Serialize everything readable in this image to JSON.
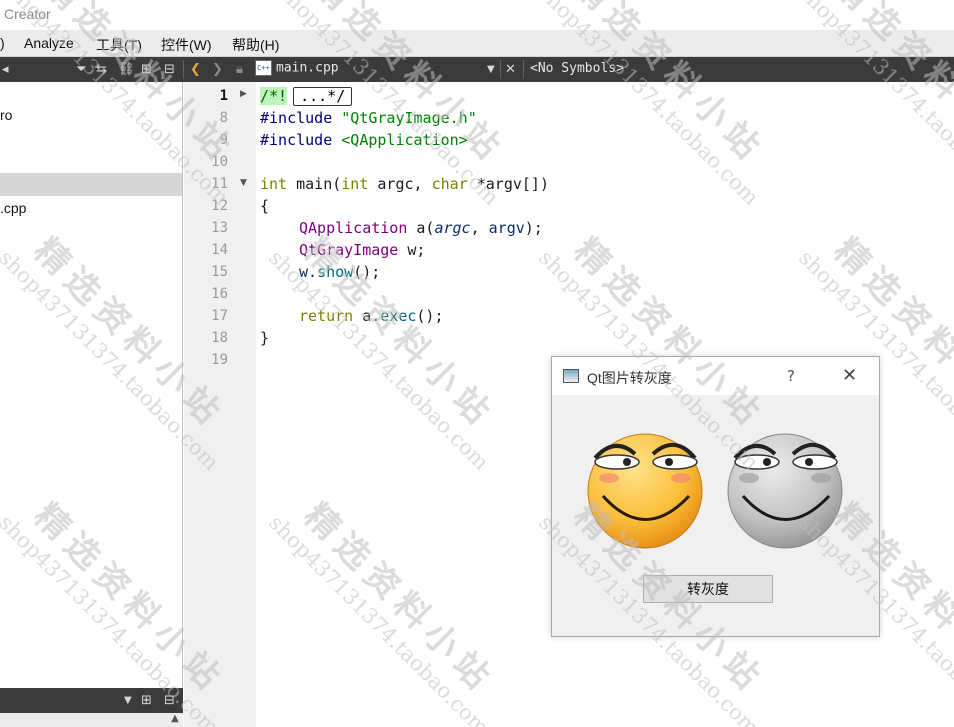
{
  "window": {
    "title": "Creator"
  },
  "menu": [
    {
      "label": ")"
    },
    {
      "label": "Analyze"
    },
    {
      "label": "工具(T)"
    },
    {
      "label": "控件(W)"
    },
    {
      "label": "帮助(H)"
    }
  ],
  "toolbar": {
    "file_tab": "main.cpp",
    "file_badge": "C++",
    "symbols": "<No Symbols>"
  },
  "left_panel": {
    "items": [
      {
        "label": "ro"
      },
      {
        "label": ".cpp"
      }
    ]
  },
  "editor": {
    "lines": [
      {
        "number": "1",
        "current": true,
        "fold": "▶"
      },
      {
        "number": "8"
      },
      {
        "number": "9"
      },
      {
        "number": "10"
      },
      {
        "number": "11",
        "fold": "▼"
      },
      {
        "number": "12"
      },
      {
        "number": "13"
      },
      {
        "number": "14"
      },
      {
        "number": "15"
      },
      {
        "number": "16"
      },
      {
        "number": "17"
      },
      {
        "number": "18"
      },
      {
        "number": "19"
      }
    ],
    "code": {
      "l1_comment": "/*!",
      "l1_collapsed": "...*/",
      "l8_directive": "#include",
      "l8_file": "\"QtGrayImage.h\"",
      "l9_directive": "#include",
      "l9_file": "<QApplication>",
      "l11_int": "int",
      "l11_main": " main(",
      "l11_int2": "int",
      "l11_argc": " argc, ",
      "l11_char": "char",
      "l11_rest": " *argv[])",
      "l12": "{",
      "l13_type": "QApplication",
      "l13_mid": " a(",
      "l13_argc": "argc",
      "l13_sep": ", ",
      "l13_argv": "argv",
      "l13_end": ");",
      "l14_type": "QtGrayImage",
      "l14_rest": " w;",
      "l15_w": "w.",
      "l15_show": "show",
      "l15_end": "();",
      "l17_return": "return",
      "l17_a": " a.",
      "l17_exec": "exec",
      "l17_end": "();",
      "l18": "}"
    }
  },
  "dialog": {
    "title": "Qt图片转灰度",
    "help": "?",
    "close": "✕",
    "button_label": "转灰度"
  },
  "watermark": {
    "brand": "精选资料小站",
    "shop": "shop437131374.taobao.com"
  },
  "colors": {
    "toolbar_bg": "#3b3b3b",
    "keyword": "#808000",
    "string": "#008000",
    "type": "#800080"
  }
}
